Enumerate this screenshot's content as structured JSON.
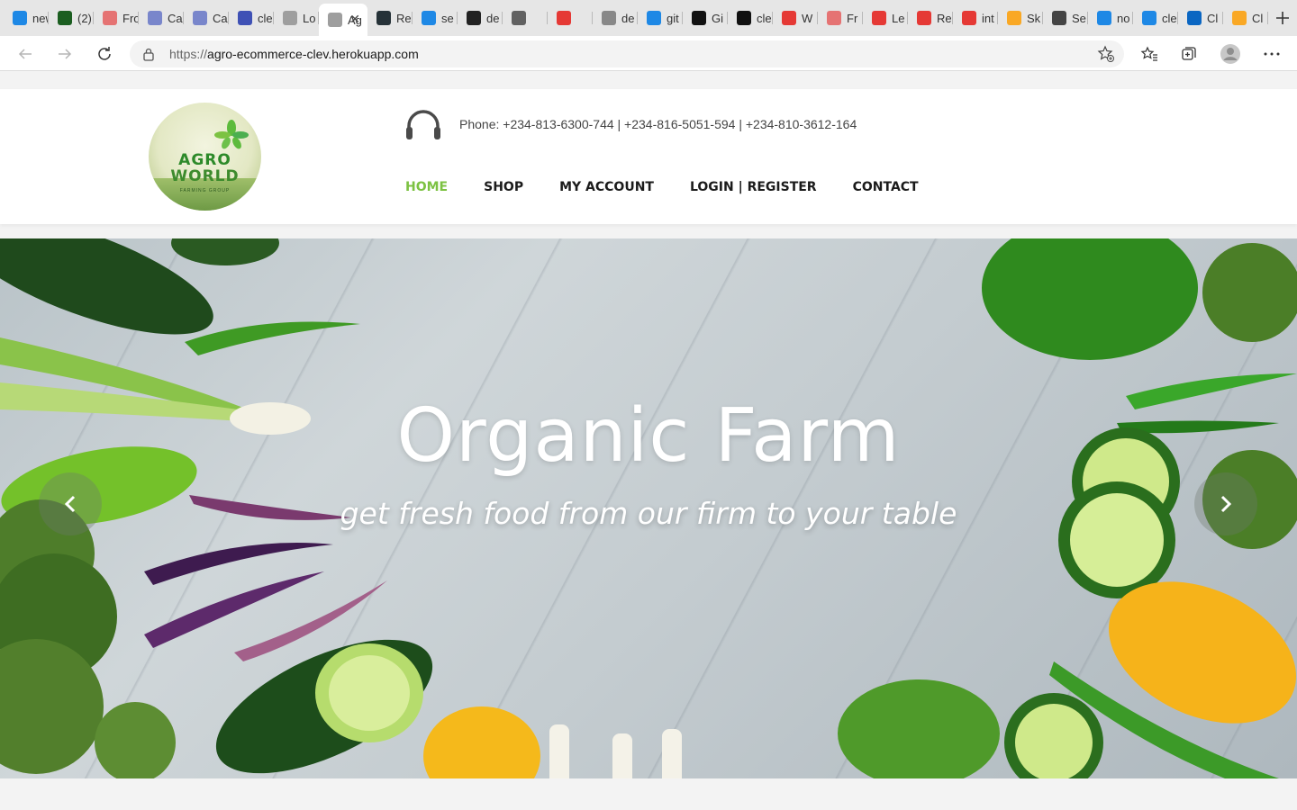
{
  "browser": {
    "tabs": [
      {
        "title": "new",
        "favicon": "bing-icon",
        "color": "#1e88e5"
      },
      {
        "title": "(2)",
        "favicon": "notion-n-icon",
        "color": "#1b5e20"
      },
      {
        "title": "Fro",
        "favicon": "gmail-icon",
        "color": "#e57373"
      },
      {
        "title": "Ca",
        "favicon": "docs-icon",
        "color": "#7986cb"
      },
      {
        "title": "Ca",
        "favicon": "docs-icon",
        "color": "#7986cb"
      },
      {
        "title": "cle",
        "favicon": "docs-icon",
        "color": "#3f51b5"
      },
      {
        "title": "Lo",
        "favicon": "page-icon",
        "color": "#9e9e9e"
      },
      {
        "title": "Ag",
        "favicon": "page-icon",
        "color": "#9e9e9e",
        "active": true
      },
      {
        "title": "Re",
        "favicon": "react-icon",
        "color": "#263238"
      },
      {
        "title": "se",
        "favicon": "bing-icon",
        "color": "#1e88e5"
      },
      {
        "title": "de",
        "favicon": "devto-icon",
        "color": "#222222"
      },
      {
        "title": "",
        "favicon": "chat-icon",
        "color": "#616161"
      },
      {
        "title": "",
        "favicon": "heart-icon",
        "color": "#e53935"
      },
      {
        "title": "de",
        "favicon": "devto-icon",
        "color": "#888888"
      },
      {
        "title": "git",
        "favicon": "bing-icon",
        "color": "#1e88e5"
      },
      {
        "title": "Gi",
        "favicon": "github-icon",
        "color": "#111111"
      },
      {
        "title": "cle",
        "favicon": "github-icon",
        "color": "#111111"
      },
      {
        "title": "W",
        "favicon": "youtube-icon",
        "color": "#e53935"
      },
      {
        "title": "Fr",
        "favicon": "gmail-icon",
        "color": "#e57373"
      },
      {
        "title": "Le",
        "favicon": "youtube-icon",
        "color": "#e53935"
      },
      {
        "title": "Re",
        "favicon": "youtube-icon",
        "color": "#e53935"
      },
      {
        "title": "int",
        "favicon": "youtube-icon",
        "color": "#e53935"
      },
      {
        "title": "Sk",
        "favicon": "sketch-icon",
        "color": "#f9a825"
      },
      {
        "title": "Se",
        "favicon": "gear-icon",
        "color": "#444444"
      },
      {
        "title": "no",
        "favicon": "bing-icon",
        "color": "#1e88e5"
      },
      {
        "title": "cle",
        "favicon": "bing-icon",
        "color": "#1e88e5"
      },
      {
        "title": "Cl",
        "favicon": "linkedin-icon",
        "color": "#0a66c2"
      },
      {
        "title": "Cl",
        "favicon": "chart-icon",
        "color": "#f9a825"
      }
    ],
    "url_protocol": "https://",
    "url_host": "agro-ecommerce-clev.herokuapp.com"
  },
  "header": {
    "logo_line1": "AGRO",
    "logo_line2": "WORLD",
    "logo_line3": "FARMING GROUP",
    "phone": "Phone: +234-813-6300-744 | +234-816-5051-594 | +234-810-3612-164",
    "nav": [
      {
        "label": "HOME",
        "active": true
      },
      {
        "label": "SHOP"
      },
      {
        "label": "MY ACCOUNT"
      },
      {
        "label": "LOGIN | REGISTER"
      },
      {
        "label": "CONTACT"
      }
    ],
    "accent_color": "#7cc242"
  },
  "hero": {
    "title": "Organic Farm",
    "subtitle": "get fresh food from our firm to your table"
  }
}
